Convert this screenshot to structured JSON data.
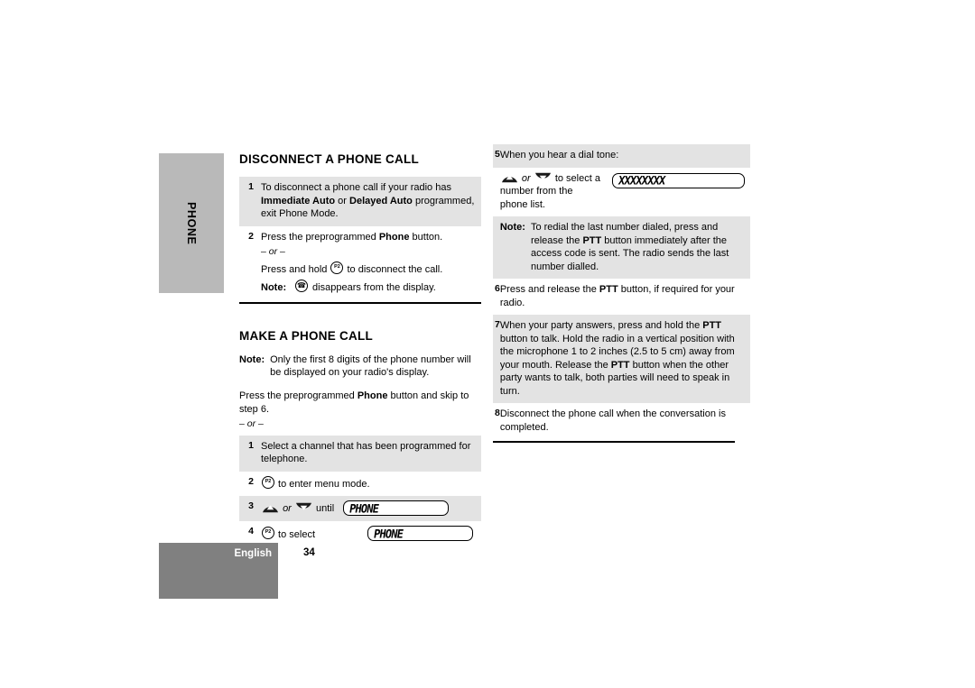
{
  "page": {
    "side_tab_label": "PHONE",
    "footer_language": "English",
    "page_number": "34",
    "colors": {
      "side_tab_gray": "#b9b9b9",
      "footer_gray": "#808080",
      "row_shade_gray": "#e3e3e3"
    }
  },
  "left_column": {
    "section1_title": "DISCONNECT A PHONE CALL",
    "section1_steps": [
      {
        "num": "1",
        "text_a": "To disconnect a phone call if your radio has ",
        "bold_a": "Immediate Auto",
        "text_b": " or ",
        "bold_b": "Delayed Auto",
        "text_c": " programmed, exit Phone Mode."
      },
      {
        "num": "2",
        "line1_a": "Press the preprogrammed ",
        "line1_bold": "Phone",
        "line1_b": " button.",
        "or": "– or –",
        "line2_a": "Press and hold ",
        "line2_icon": "p2-key-icon",
        "line2_b": " to disconnect the call.",
        "note_label": "Note:",
        "note_icon": "phone-handset-indicator-icon",
        "note_text": " disappears from the display."
      }
    ],
    "section2_title": "MAKE A PHONE CALL",
    "section2_note": {
      "label": "Note:",
      "text": "Only the first 8 digits of the phone number will be displayed on your radio's display."
    },
    "section2_intro": {
      "text_a": "Press the preprogrammed ",
      "bold": "Phone",
      "text_b": " button and skip to step 6.",
      "or": "– or –"
    },
    "section2_steps": [
      {
        "num": "1",
        "text": "Select a channel that has been programmed for telephone."
      },
      {
        "num": "2",
        "icon": "p2-key-icon",
        "text": " to enter menu mode."
      },
      {
        "num": "3",
        "icon_up": "rocker-up-icon",
        "or": "or",
        "icon_down": "rocker-down-icon",
        "text": "until",
        "lcd": "PHONE"
      },
      {
        "num": "4",
        "icon": "p2-key-icon",
        "text": " to select",
        "lcd": "PHONE"
      }
    ]
  },
  "right_column": {
    "steps": [
      {
        "num": "5",
        "heading": "When you hear a dial tone:",
        "icon_up": "rocker-up-icon",
        "or": "or",
        "icon_down": "rocker-down-icon",
        "text": "to select a number from the phone list.",
        "lcd": "XXXXXXXX"
      }
    ],
    "note": {
      "label": "Note:",
      "text_a": "To redial the last number dialed, press and release the ",
      "bold": "PTT",
      "text_b": " button immediately after the access code is sent. The radio sends the last number dialled."
    },
    "steps_cont": [
      {
        "num": "6",
        "text_a": "Press and release the ",
        "bold": "PTT",
        "text_b": " button, if required for your radio."
      },
      {
        "num": "7",
        "text_a": "When your party answers, press and hold the ",
        "bold_a": "PTT",
        "text_b": " button to talk. Hold the radio in a vertical position with the microphone 1 to 2 inches (2.5 to 5 cm) away from your mouth. Release the ",
        "bold_b": "PTT",
        "text_c": " button when the other party wants to talk, both parties will need to speak in turn."
      },
      {
        "num": "8",
        "text": "Disconnect the phone call when the conversation is completed."
      }
    ]
  }
}
